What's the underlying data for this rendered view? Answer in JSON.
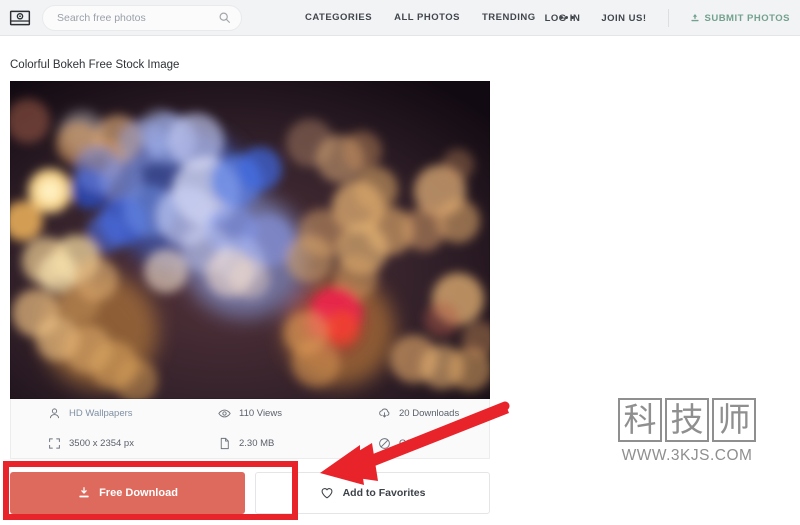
{
  "header": {
    "logo_icon": "camera-icon",
    "search": {
      "placeholder": "Search free photos",
      "value": "",
      "icon": "search-icon"
    },
    "nav": [
      {
        "label": "CATEGORIES"
      },
      {
        "label": "ALL PHOTOS"
      },
      {
        "label": "TRENDING"
      }
    ],
    "more_icon": "ellipsis-icon",
    "account": [
      {
        "label": "LOG IN"
      },
      {
        "label": "JOIN US!"
      }
    ],
    "submit": {
      "label": "SUBMIT PHOTOS",
      "icon": "upload-icon",
      "color": "#73a18d"
    }
  },
  "page": {
    "title": "Colorful Bokeh Free Stock Image"
  },
  "photo": {
    "alt": "Colorful bokeh lights photograph"
  },
  "meta": [
    {
      "icon": "user-icon",
      "text": "HD Wallpapers",
      "link": true
    },
    {
      "icon": "eye-icon",
      "text": "110 Views",
      "link": false
    },
    {
      "icon": "download-cloud-icon",
      "text": "20 Downloads",
      "link": false
    },
    {
      "icon": "resize-icon",
      "text": "3500 x 2354 px",
      "link": false
    },
    {
      "icon": "file-icon",
      "text": "2.30 MB",
      "link": false
    },
    {
      "icon": "cc0-icon",
      "text": "CC0",
      "link": false
    }
  ],
  "actions": {
    "download": {
      "label": "Free Download",
      "icon": "download-icon",
      "color": "#dd6a5d"
    },
    "favorite": {
      "label": "Add to Favorites",
      "icon": "heart-icon"
    }
  },
  "annotations": {
    "highlight_color": "#e8232a",
    "arrow_color": "#e8232a"
  },
  "watermark": {
    "chars": [
      "科",
      "技",
      "师"
    ],
    "url": "WWW.3KJS.COM",
    "color": "#8f8f8f"
  }
}
